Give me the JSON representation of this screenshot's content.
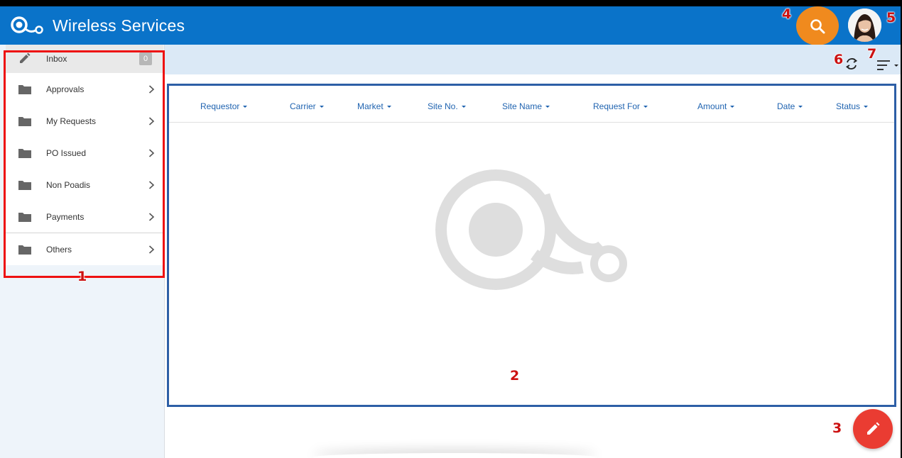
{
  "header": {
    "title": "Wireless Services",
    "brand_color": "#0a73c9",
    "search_color": "#f08a1e"
  },
  "sidebar": {
    "inbox": {
      "label": "Inbox",
      "count": "0"
    },
    "items": [
      {
        "label": "Approvals"
      },
      {
        "label": "My Requests"
      },
      {
        "label": "PO Issued"
      },
      {
        "label": "Non Poadis"
      },
      {
        "label": "Payments"
      },
      {
        "label": "Others"
      }
    ]
  },
  "table": {
    "columns": [
      "Requestor",
      "Carrier",
      "Market",
      "Site No.",
      "Site Name",
      "Request For",
      "Amount",
      "Date",
      "Status"
    ]
  },
  "annotations": [
    "1",
    "2",
    "3",
    "4",
    "5",
    "6",
    "7"
  ],
  "fab_color": "#ea3c32"
}
